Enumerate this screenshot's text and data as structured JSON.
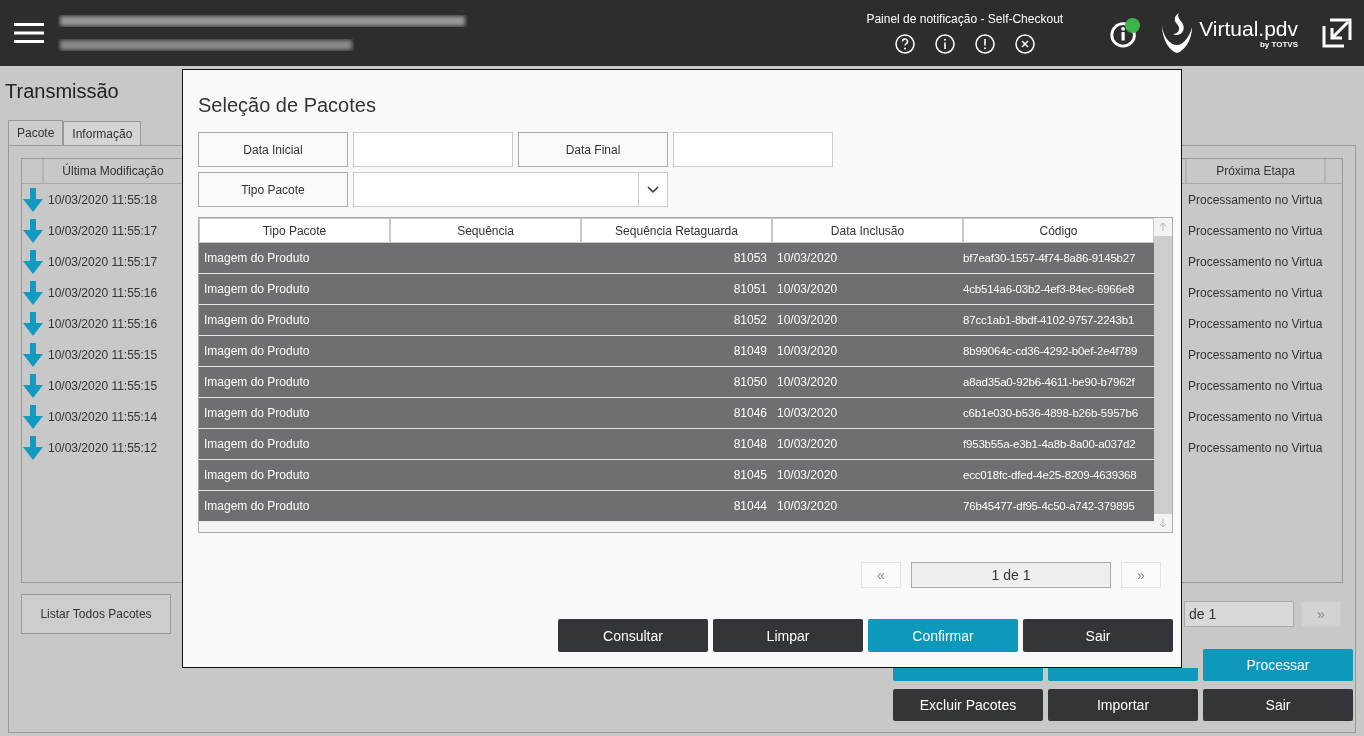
{
  "header": {
    "notification_title": "Painel de notificação - Self-Checkout",
    "logo_text": "Virtual.pdv",
    "logo_sub": "by TOTVS"
  },
  "page": {
    "title": "Transmissão",
    "tabs": [
      {
        "label": "Pacote",
        "selected": true
      },
      {
        "label": "Informação",
        "selected": false
      }
    ],
    "table": {
      "columns": [
        "Última Modificação",
        "Próxima Etapa"
      ],
      "rows": [
        {
          "modified": "10/03/2020 11:55:18",
          "next_step": "Processamento no Virtua"
        },
        {
          "modified": "10/03/2020 11:55:17",
          "next_step": "Processamento no Virtua"
        },
        {
          "modified": "10/03/2020 11:55:17",
          "next_step": "Processamento no Virtua"
        },
        {
          "modified": "10/03/2020 11:55:16",
          "next_step": "Processamento no Virtua"
        },
        {
          "modified": "10/03/2020 11:55:16",
          "next_step": "Processamento no Virtua"
        },
        {
          "modified": "10/03/2020 11:55:15",
          "next_step": "Processamento no Virtua"
        },
        {
          "modified": "10/03/2020 11:55:15",
          "next_step": "Processamento no Virtua"
        },
        {
          "modified": "10/03/2020 11:55:14",
          "next_step": "Processamento no Virtua"
        },
        {
          "modified": "10/03/2020 11:55:12",
          "next_step": "Processamento no Virtua"
        }
      ]
    },
    "list_all_button": "Listar Todos Pacotes",
    "pager": {
      "page_text": "de 1",
      "next": "»"
    },
    "buttons": [
      {
        "kind": "primary"
      },
      {
        "kind": "primary"
      },
      {
        "kind": "primary",
        "label": "Processar"
      },
      {
        "kind": "dark",
        "label": "Excluir Pacotes"
      },
      {
        "kind": "dark",
        "label": "Importar"
      },
      {
        "kind": "dark",
        "label": "Sair"
      }
    ]
  },
  "modal": {
    "title": "Seleção de Pacotes",
    "filters": {
      "start_label": "Data Inicial",
      "end_label": "Data Final",
      "type_label": "Tipo Pacote"
    },
    "table": {
      "columns": [
        "Tipo Pacote",
        "Sequência",
        "Sequência Retaguarda",
        "Data Inclusão",
        "Código"
      ],
      "rows": [
        {
          "type": "Imagem do Produto",
          "seq_ret": "81053",
          "date": "10/03/2020",
          "code": "bf7eaf30-1557-4f74-8a86-9145b27",
          "selected": true
        },
        {
          "type": "Imagem do Produto",
          "seq_ret": "81051",
          "date": "10/03/2020",
          "code": "4cb514a6-03b2-4ef3-84ec-6966e8",
          "selected": true
        },
        {
          "type": "Imagem do Produto",
          "seq_ret": "81052",
          "date": "10/03/2020",
          "code": "87cc1ab1-8bdf-4102-9757-2243b1",
          "selected": true
        },
        {
          "type": "Imagem do Produto",
          "seq_ret": "81049",
          "date": "10/03/2020",
          "code": "8b99064c-cd36-4292-b0ef-2e4f789",
          "selected": true
        },
        {
          "type": "Imagem do Produto",
          "seq_ret": "81050",
          "date": "10/03/2020",
          "code": "a8ad35a0-92b6-4611-be90-b7962f",
          "selected": true
        },
        {
          "type": "Imagem do Produto",
          "seq_ret": "81046",
          "date": "10/03/2020",
          "code": "c6b1e030-b536-4898-b26b-5957b6",
          "selected": true
        },
        {
          "type": "Imagem do Produto",
          "seq_ret": "81048",
          "date": "10/03/2020",
          "code": "f953b55a-e3b1-4a8b-8a00-a037d2",
          "selected": true
        },
        {
          "type": "Imagem do Produto",
          "seq_ret": "81045",
          "date": "10/03/2020",
          "code": "ecc018fc-dfed-4e25-8209-4639368",
          "selected": true
        },
        {
          "type": "Imagem do Produto",
          "seq_ret": "81044",
          "date": "10/03/2020",
          "code": "76b45477-df95-4c50-a742-379895",
          "selected": true
        }
      ]
    },
    "pager": {
      "prev": "«",
      "page": "1 de 1",
      "next": "»"
    },
    "buttons": [
      {
        "kind": "dark",
        "label": "Consultar"
      },
      {
        "kind": "dark",
        "label": "Limpar"
      },
      {
        "kind": "primary",
        "label": "Confirmar"
      },
      {
        "kind": "dark",
        "label": "Sair"
      }
    ]
  }
}
